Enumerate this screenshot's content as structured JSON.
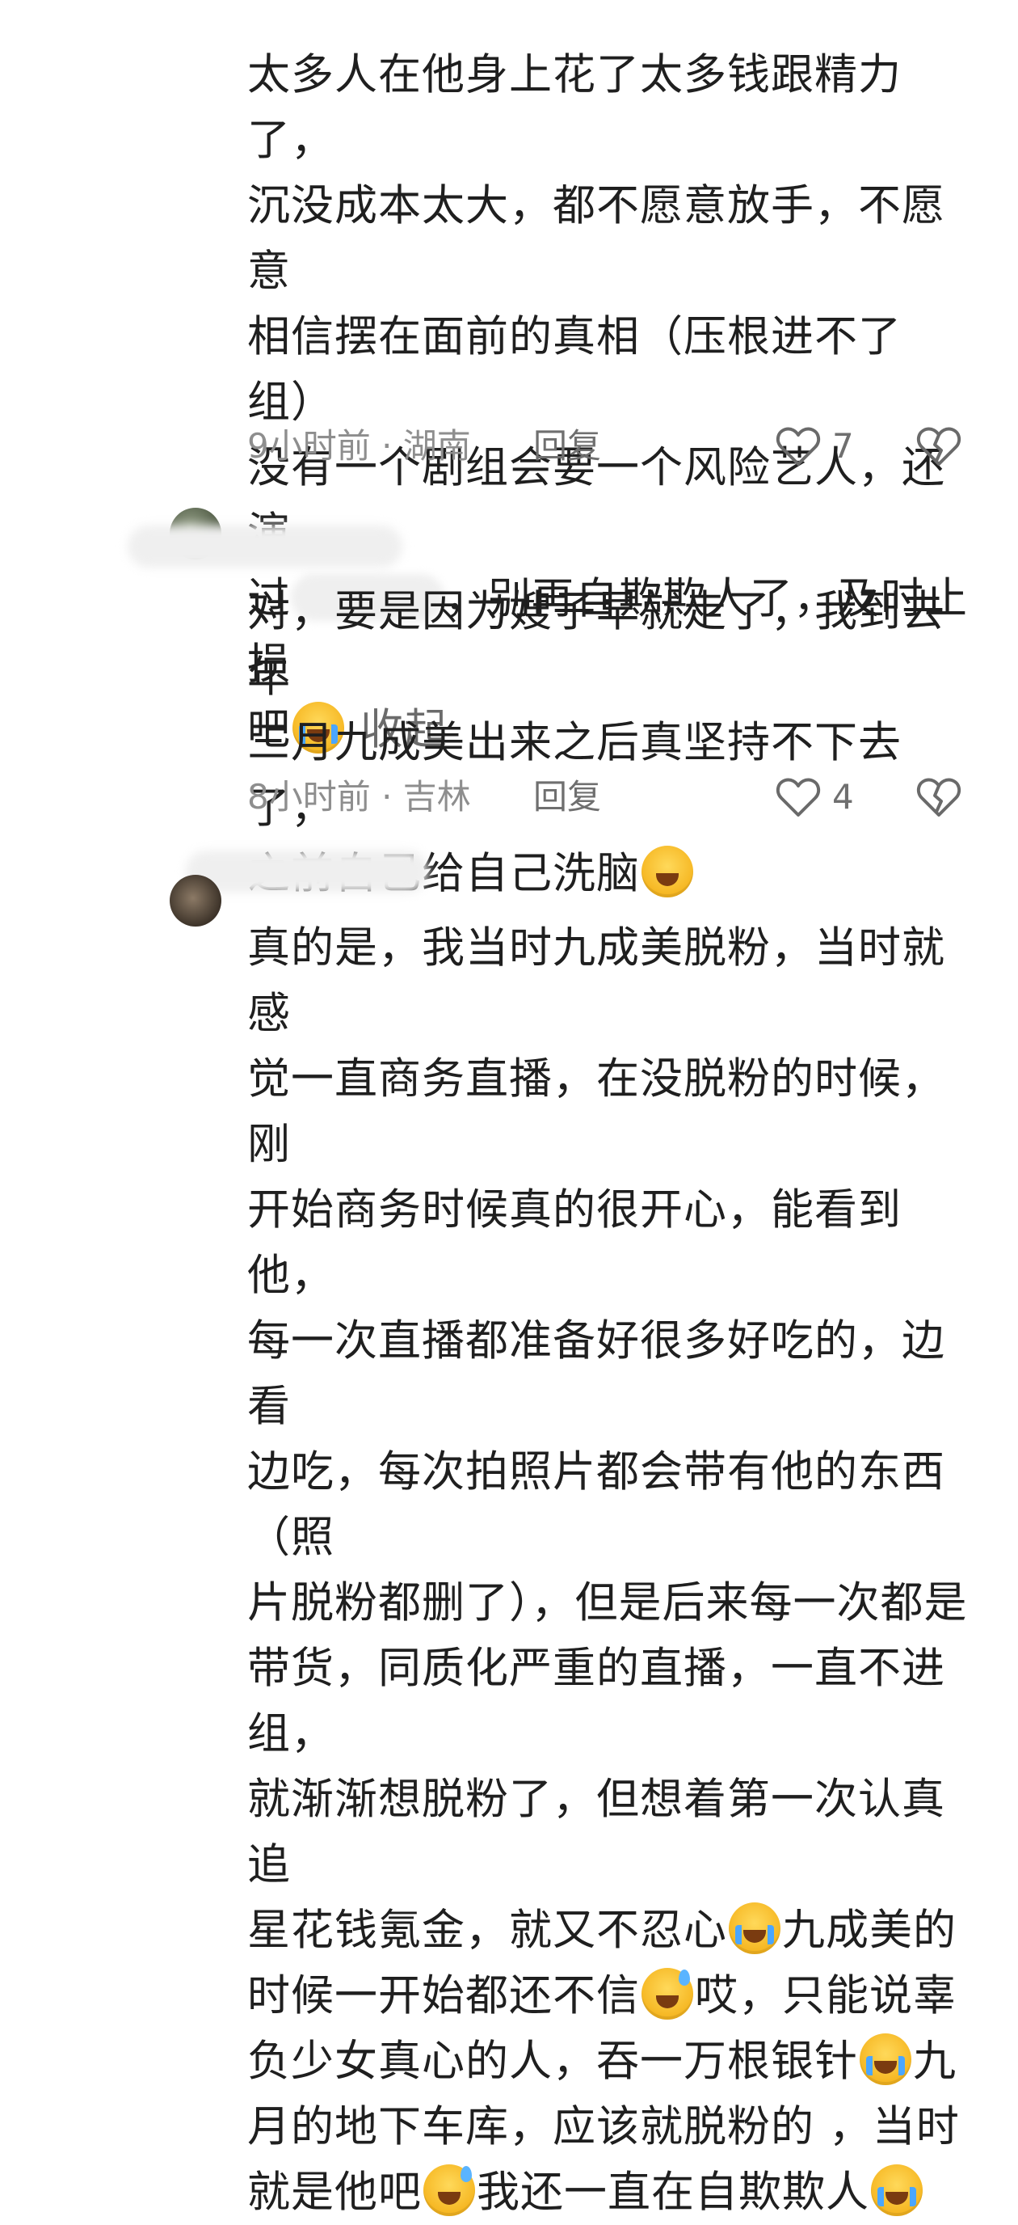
{
  "comments": [
    {
      "lines": [
        "太多人在他身上花了太多钱跟精力了，",
        "沉没成本太大，都不愿意放手，不愿意",
        "相信摆在面前的真相（压根进不了组）",
        "没有一个剧组会要一个风险艺人，还演",
        "过",
        "，别再自欺欺人了，及时止损",
        "吧"
      ],
      "expand_label": "收起",
      "time": "9小时前 · 湖南",
      "reply_label": "回复",
      "likes": "7"
    },
    {
      "lines": [
        "对，要是因为嫂子早就走了，我到去年",
        "三月九成美出来之后真坚持不下去了，",
        "之前自己给自己洗脑"
      ],
      "time": "8小时前 · 吉林",
      "reply_label": "回复",
      "likes": "4"
    },
    {
      "lines": [
        "真的是，我当时九成美脱粉，当时就感",
        "觉一直商务直播，在没脱粉的时候，刚",
        "开始商务时候真的很开心，能看到他，",
        "每一次直播都准备好很多好吃的，边看",
        "边吃，每次拍照片都会带有他的东西（照",
        "片脱粉都删了），但是后来每一次都是",
        "带货，同质化严重的直播，一直不进组，",
        "就渐渐想脱粉了，但想着第一次认真追",
        "星花钱氪金，就又不忍心",
        "九成美的",
        "时候一开始都还不信",
        "哎，只能说辜",
        "负少女真心的人，吞一万根银针",
        "九",
        "月的地下车库，应该就脱粉的 ，当时",
        "就是他吧",
        "我还一直在自欺欺人"
      ]
    }
  ],
  "icons": {
    "like": "heart-outline-icon",
    "dislike": "broken-heart-icon",
    "emoji_cry": "loudly-crying-face-emoji",
    "emoji_hold_tears": "holding-back-tears-emoji",
    "emoji_grin_sweat": "grinning-sweat-emoji"
  },
  "colors": {
    "background": "#ffffff",
    "text": "#1f1f1f",
    "meta": "#8e8e8e"
  }
}
